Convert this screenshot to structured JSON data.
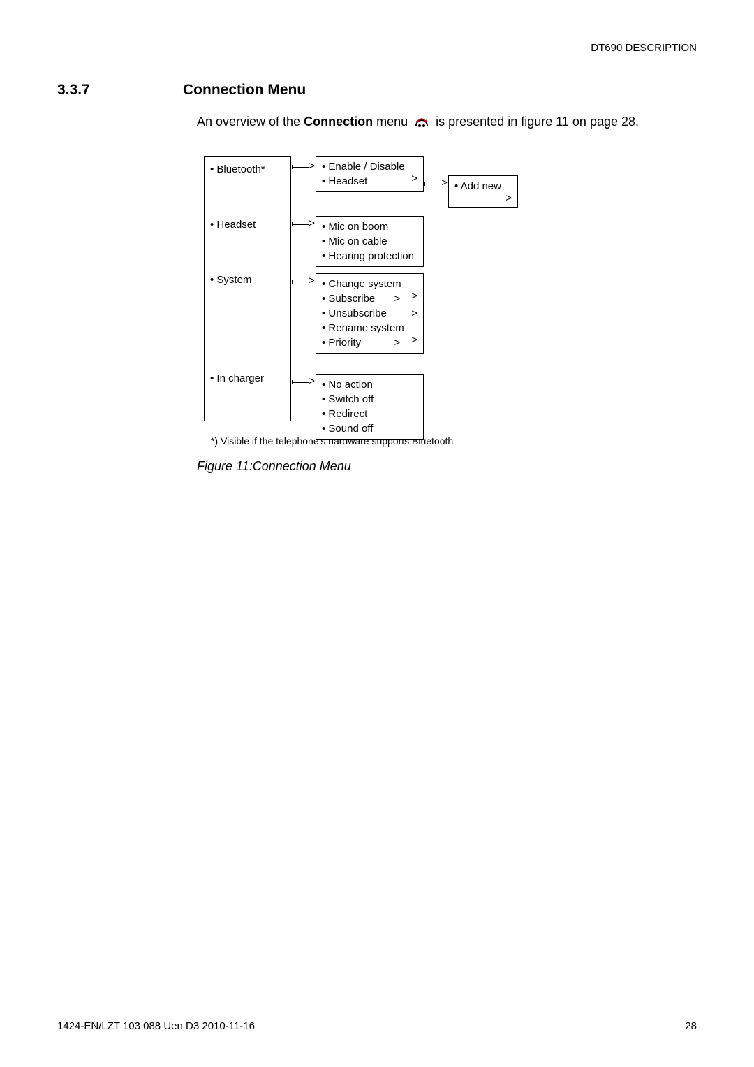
{
  "header": {
    "right": "DT690 DESCRIPTION"
  },
  "section": {
    "num": "3.3.7",
    "title": "Connection Menu"
  },
  "intro": {
    "t1": "An overview of the ",
    "bold": "Connection",
    "t2": " menu ",
    "t3": " is presented in figure 11 on page 28."
  },
  "diagram": {
    "col1": {
      "bluetooth": "Bluetooth*",
      "headset": "Headset",
      "system": "System",
      "incharger": "In charger"
    },
    "bluetooth_sub": {
      "enable": "Enable / Disable",
      "headset": "Headset"
    },
    "headset_sub": {
      "micboom": "Mic on boom",
      "miccable": "Mic on cable",
      "hearing": "Hearing protection"
    },
    "system_sub": {
      "change": "Change system",
      "subscribe": "Subscribe",
      "unsubscribe": "Unsubscribe",
      "rename": "Rename system",
      "priority": "Priority"
    },
    "incharger_sub": {
      "noaction": "No action",
      "switchoff": "Switch off",
      "redirect": "Redirect",
      "soundoff": "Sound off"
    },
    "addnew": "Add new"
  },
  "footnote": "*) Visible if the telephone's hardware supports Bluetooth",
  "figcaption": "Figure 11:Connection Menu",
  "footer": {
    "left": "1424-EN/LZT 103 088 Uen D3 2010-11-16",
    "right": "28"
  }
}
